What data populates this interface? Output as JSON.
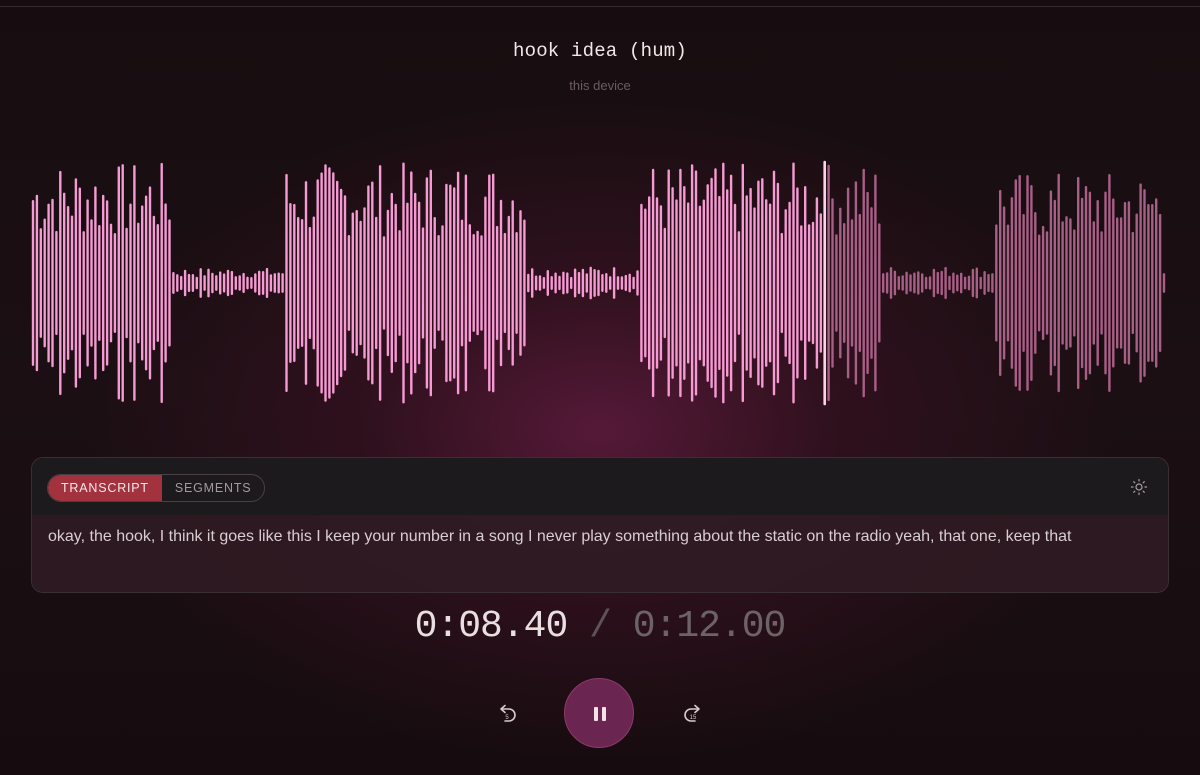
{
  "recording": {
    "title": "hook idea (hum)",
    "source": "this device"
  },
  "waveform": {
    "progress": 0.7,
    "played_color": "#f59ad2",
    "unplayed_color": "#a85f86",
    "playhead_color": "#ffd1ea"
  },
  "panel": {
    "tabs": [
      {
        "label": "TRANSCRIPT",
        "active": true
      },
      {
        "label": "SEGMENTS",
        "active": false
      }
    ],
    "settings_icon": "sun-icon",
    "transcript": "okay, the hook, I think it goes like this I keep your number in a song I never play something about the static on the radio yeah, that one, keep that"
  },
  "playback": {
    "current_time": "0:08.40",
    "separator": "/",
    "duration": "0:12.00",
    "state": "playing"
  },
  "controls": {
    "rewind_icon": "rewind-5-icon",
    "pause_icon": "pause-icon",
    "forward_icon": "forward-15-icon"
  }
}
